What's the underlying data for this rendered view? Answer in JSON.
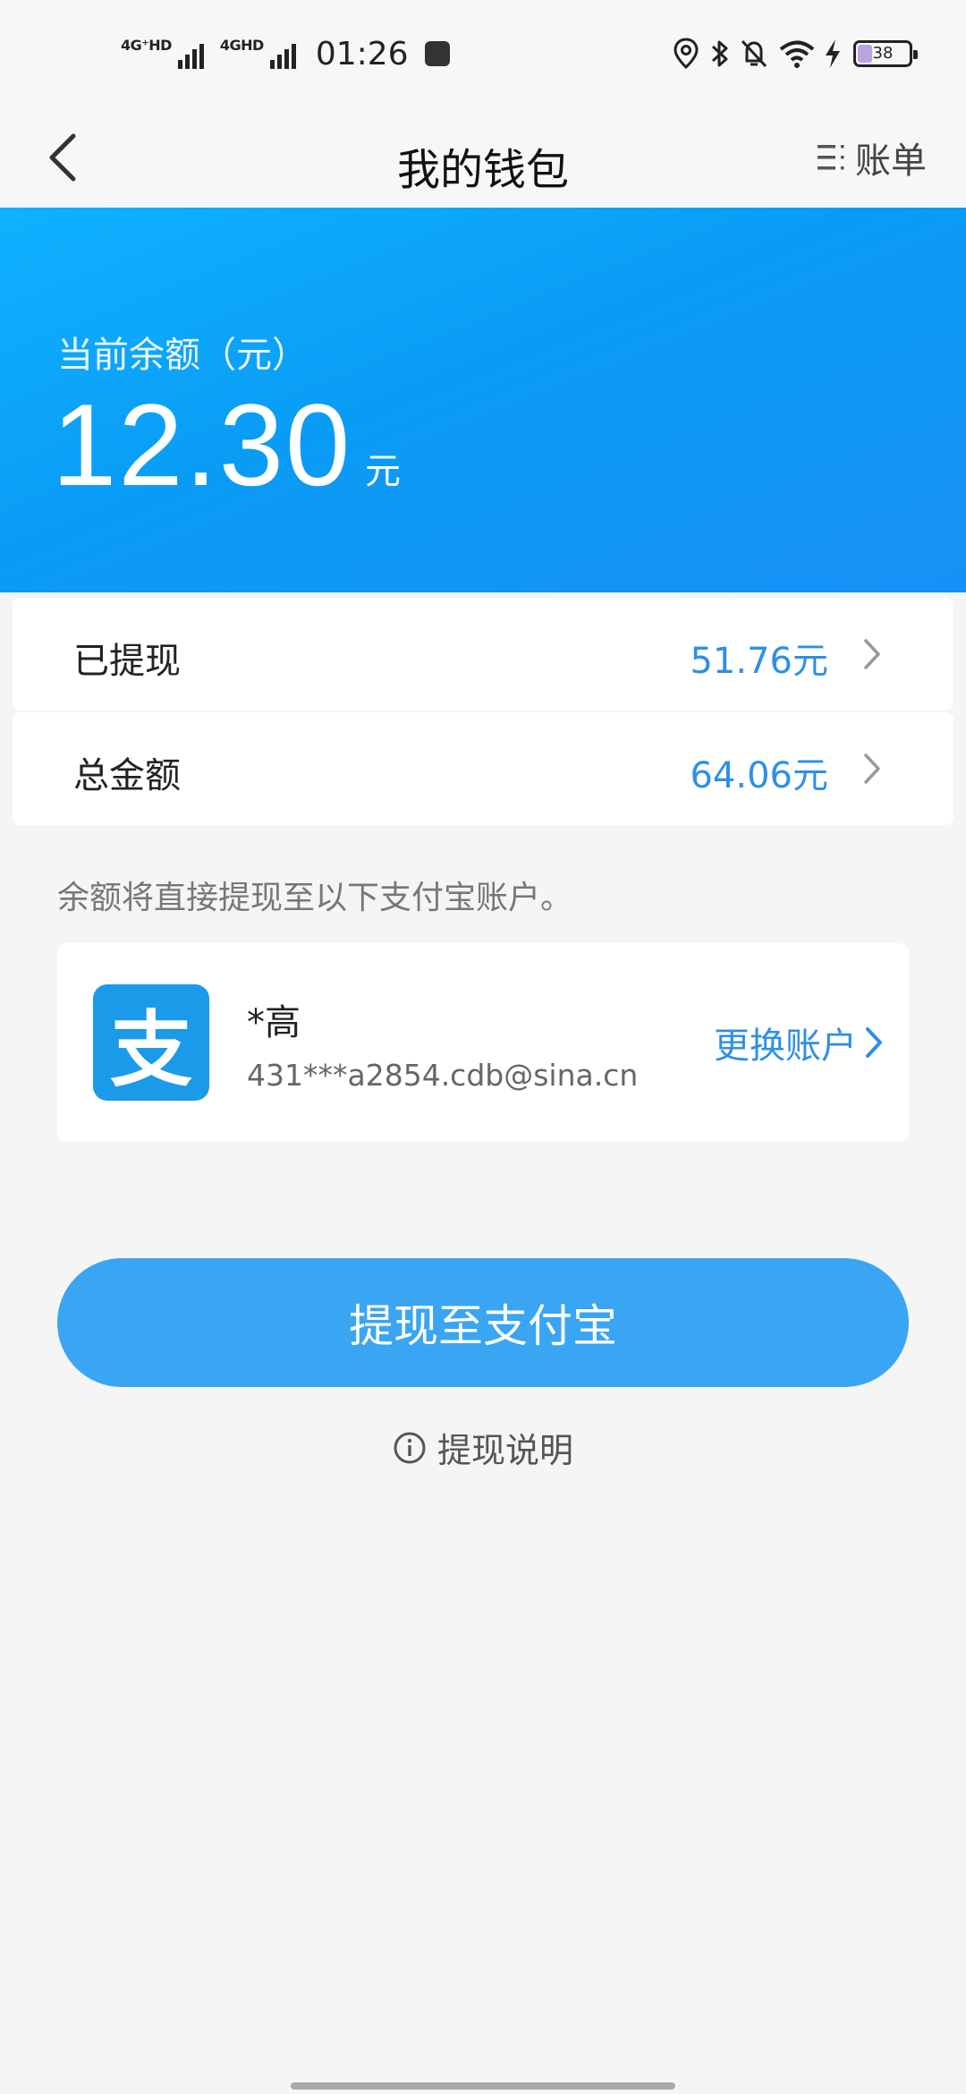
{
  "status_bar": {
    "network_1": "4G⁺HD",
    "network_2": "4GHD",
    "time": "01:26",
    "battery": "38"
  },
  "nav": {
    "title": "我的钱包",
    "bill_label": "账单"
  },
  "balance": {
    "label": "当前余额（元）",
    "amount": "12.30",
    "unit": "元"
  },
  "summary": [
    {
      "label": "已提现",
      "value": "51.76元"
    },
    {
      "label": "总金额",
      "value": "64.06元"
    }
  ],
  "hint": "余额将直接提现至以下支付宝账户。",
  "account": {
    "logo_char": "支",
    "name": "*高",
    "email": "431***a2854.cdb@sina.cn",
    "change_label": "更换账户"
  },
  "withdraw_button": "提现至支付宝",
  "withdraw_info": "提现说明",
  "colors": {
    "accent": "#2f8fe6",
    "header_gradient_start": "#0fb2ff",
    "header_gradient_end": "#1790f5",
    "button": "#3aa5f2",
    "alipay": "#1a9ae8"
  },
  "icons": {
    "back": "chevron-left-icon",
    "bill": "list-icon",
    "row_chevron": "chevron-right-icon",
    "info": "info-circle-icon"
  }
}
